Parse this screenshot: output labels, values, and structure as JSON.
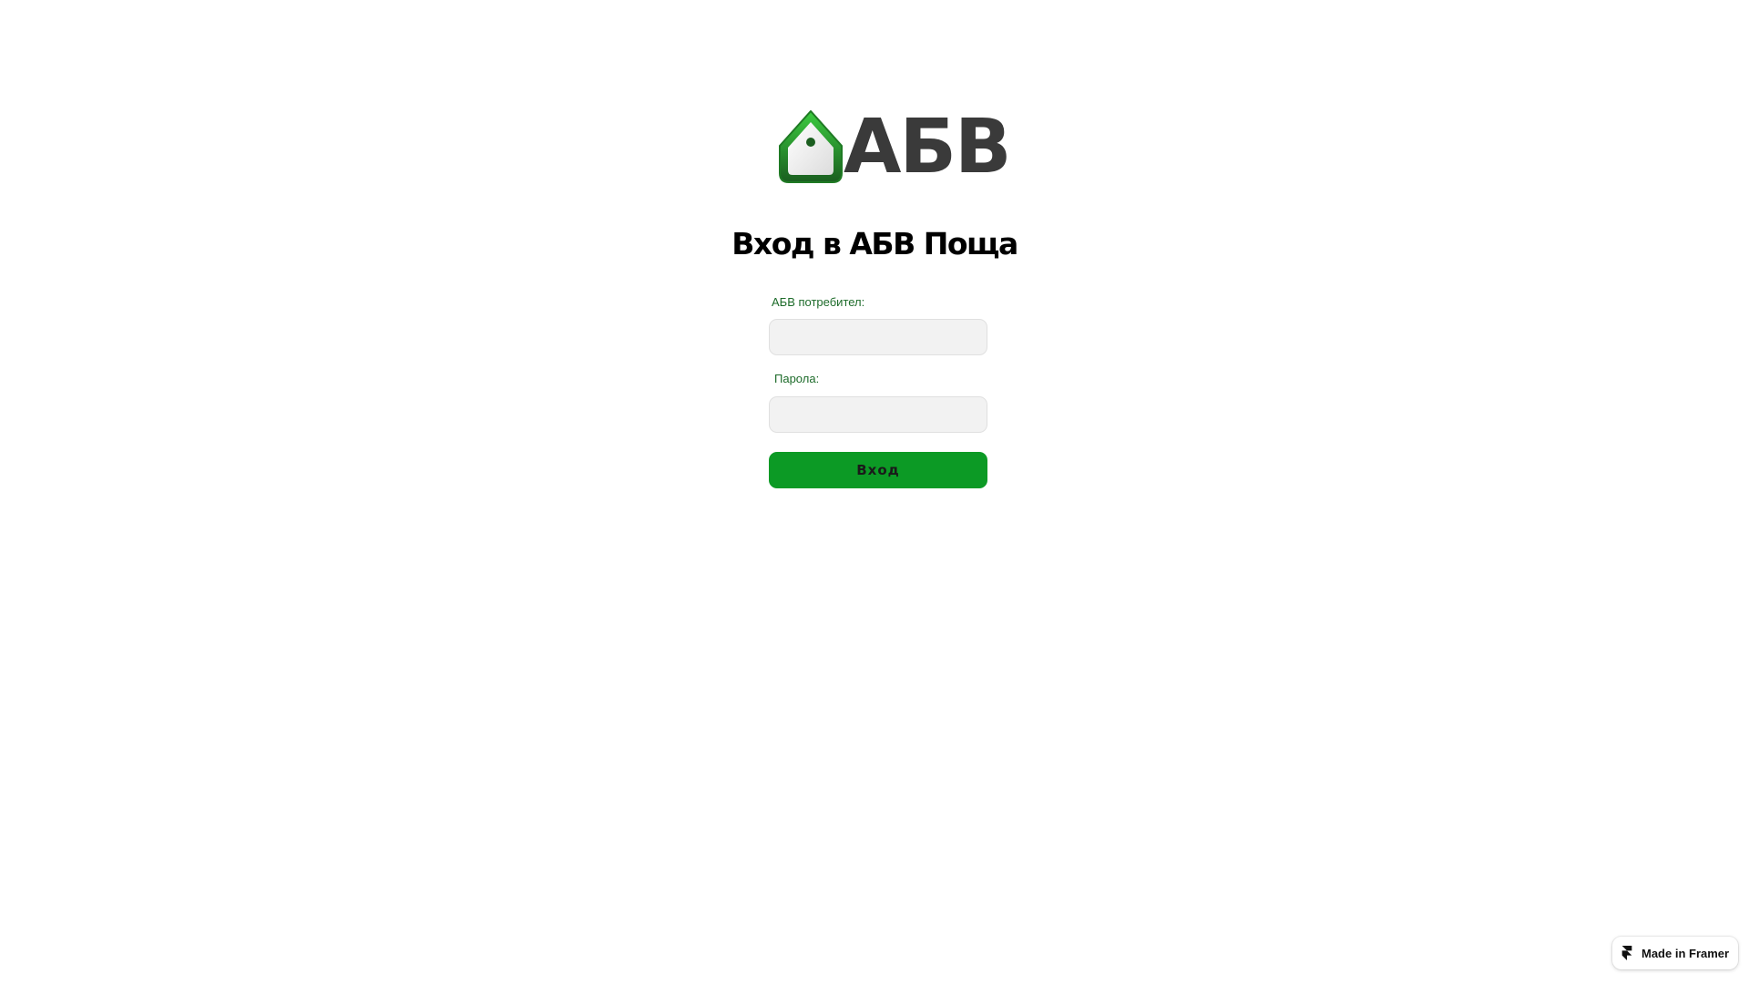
{
  "brand": {
    "logo_text": "АБВ",
    "colors": {
      "house_green_light": "#38c43c",
      "house_green_dark": "#1e6b22",
      "text_dark": "#3a3a3a"
    }
  },
  "login": {
    "title": "Вход в АБВ Поща",
    "username_label": "АБВ потребител:",
    "username_value": "",
    "password_label": "Парола:",
    "password_value": "",
    "submit_label": "Вход"
  },
  "colors": {
    "label_green": "#1d6b2a",
    "button_green": "#0c9a25",
    "field_background": "#f2f2f2"
  },
  "footer": {
    "badge_label": "Made in Framer",
    "badge_icon": "framer-icon"
  }
}
